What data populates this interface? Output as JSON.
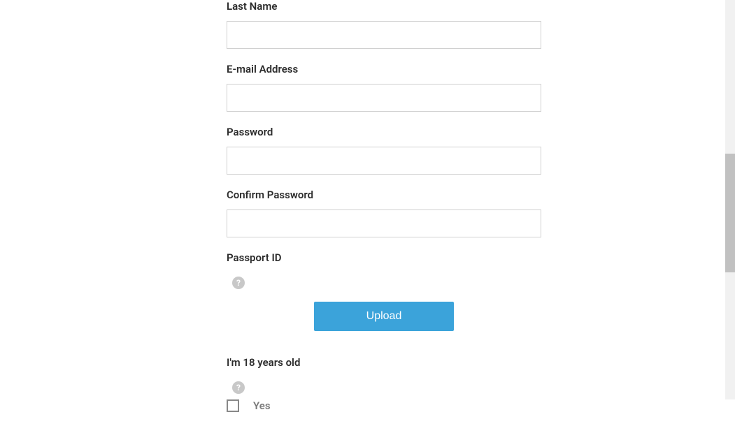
{
  "form": {
    "lastName": {
      "label": "Last Name",
      "value": ""
    },
    "email": {
      "label": "E-mail Address",
      "value": ""
    },
    "password": {
      "label": "Password",
      "value": ""
    },
    "confirmPassword": {
      "label": "Confirm Password",
      "value": ""
    },
    "passportId": {
      "label": "Passport ID",
      "uploadButton": "Upload"
    },
    "ageConfirm": {
      "label": "I'm 18 years old",
      "option": "Yes",
      "checked": false
    }
  },
  "helpIconGlyph": "?"
}
